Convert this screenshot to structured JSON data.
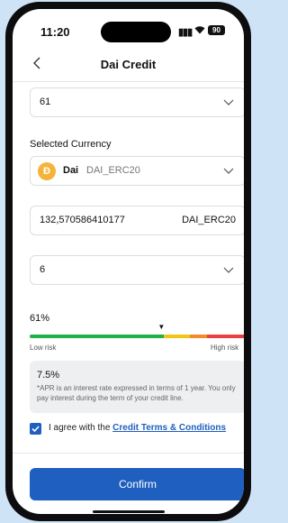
{
  "status_bar": {
    "time": "11:20",
    "battery": "90",
    "wifi_icon": "wifi-icon",
    "signal_icon": "signal-icon"
  },
  "nav": {
    "title": "Dai Credit",
    "back_icon": "chevron-left-icon"
  },
  "term_select": {
    "value": "61"
  },
  "currency": {
    "label": "Selected Currency",
    "name": "Dai",
    "code": "DAI_ERC20",
    "icon_glyph": "Ð",
    "icon_color": "#f4b43a"
  },
  "amount": {
    "value": "132,570586410177",
    "currency": "DAI_ERC20"
  },
  "second_select": {
    "value": "6"
  },
  "risk": {
    "percent_label": "61%",
    "level": 0.61,
    "low_label": "Low risk",
    "high_label": "High risk",
    "colors": {
      "low": "#22b04b",
      "mid": "#f2c413",
      "high_mid": "#f28b2a",
      "high": "#e84141"
    }
  },
  "apr": {
    "value": "7.5%",
    "note": "*APR is an interest rate expressed in terms of 1 year. You only pay interest during the term of your credit line."
  },
  "agreement": {
    "checked": true,
    "text": "I agree with the ",
    "link": "Credit Terms & Conditions"
  },
  "confirm_label": "Confirm",
  "accent_color": "#1f5fbf"
}
